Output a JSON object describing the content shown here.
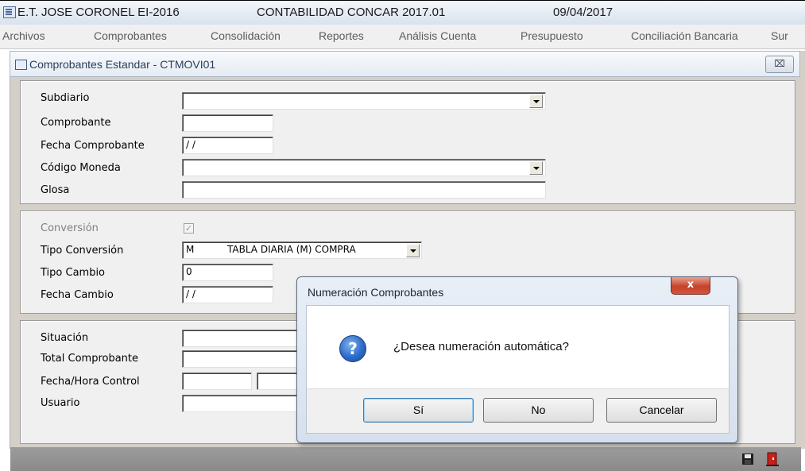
{
  "titlebar": {
    "company": "E.T. JOSE CORONEL EI-2016",
    "app": "CONTABILIDAD CONCAR 2017.01",
    "date": "09/04/2017"
  },
  "menu": [
    "Archivos",
    "Comprobantes",
    "Consolidación",
    "Reportes",
    "Análisis Cuenta",
    "Presupuesto",
    "Conciliación Bancaria",
    "Sur"
  ],
  "child_window": {
    "title": "Comprobantes Estandar - CTMOVI01",
    "close_glyph": "⌧"
  },
  "section1": {
    "subdiario_label": "Subdiario",
    "subdiario_value": "",
    "comprobante_label": "Comprobante",
    "comprobante_value": "",
    "fecha_label": "Fecha Comprobante",
    "fecha_value": "/ /",
    "moneda_label": "Código Moneda",
    "moneda_value": "",
    "glosa_label": "Glosa",
    "glosa_value": ""
  },
  "section2": {
    "conversion_label": "Conversión",
    "conversion_checked": true,
    "tipo_conv_label": "Tipo Conversión",
    "tipo_conv_code": "M",
    "tipo_conv_desc": "TABLA DIARIA (M) COMPRA",
    "tipo_cambio_label": "Tipo Cambio",
    "tipo_cambio_value": "0",
    "fecha_cambio_label": "Fecha Cambio",
    "fecha_cambio_value": "/ /"
  },
  "section3": {
    "situacion_label": "Situación",
    "total_label": "Total Comprobante",
    "fecha_hora_label": "Fecha/Hora Control",
    "usuario_label": "Usuario"
  },
  "dialog": {
    "title": "Numeración Comprobantes",
    "close_glyph": "x",
    "icon": "question-icon",
    "message": "¿Desea numeración automática?",
    "buttons": {
      "yes": "Sí",
      "no": "No",
      "cancel": "Cancelar"
    }
  },
  "colors": {
    "window_bg": "#d4d0c8",
    "dialog_close": "#c7422a",
    "question_icon": "#2d6bc9"
  }
}
